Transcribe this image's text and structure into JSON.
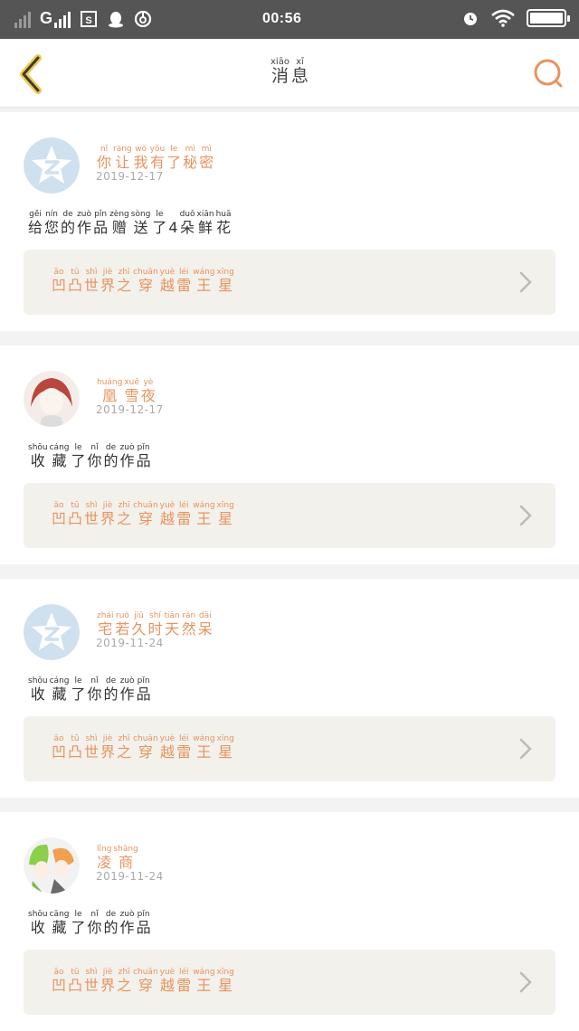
{
  "status_bar": {
    "carrier_label": "G",
    "time": "00:56",
    "icons": [
      "signal-icon-dim",
      "signal-icon",
      "sim-icon",
      "qq-icon",
      "netease-music-icon",
      "alarm-icon",
      "wifi-icon",
      "battery-icon"
    ],
    "battery_level": 1.0
  },
  "navbar": {
    "title": [
      {
        "py": "xiāo",
        "hz": "消"
      },
      {
        "py": "xī",
        "hz": "息"
      }
    ],
    "back_icon": "back-chevron-icon",
    "search_icon": "search-icon",
    "accent_color": "#e8935e"
  },
  "messages": [
    {
      "avatar": "qzone-default-avatar",
      "name": [
        {
          "py": "nǐ",
          "hz": "你"
        },
        {
          "py": "ràng",
          "hz": "让"
        },
        {
          "py": "wǒ",
          "hz": "我"
        },
        {
          "py": "yǒu",
          "hz": "有"
        },
        {
          "py": "le",
          "hz": "了"
        },
        {
          "py": "mì",
          "hz": "秘"
        },
        {
          "py": "mì",
          "hz": "密"
        }
      ],
      "date": "2019-12-17",
      "action": [
        {
          "py": "gěi",
          "hz": "给"
        },
        {
          "py": "nín",
          "hz": "您"
        },
        {
          "py": "de",
          "hz": "的"
        },
        {
          "py": "zuò",
          "hz": "作"
        },
        {
          "py": "pǐn",
          "hz": "品"
        },
        {
          "py": "zèng",
          "hz": "赠"
        },
        {
          "py": "sòng",
          "hz": "送"
        },
        {
          "py": "le",
          "hz": "了"
        },
        {
          "py": "",
          "hz": "4"
        },
        {
          "py": "duǒ",
          "hz": "朵"
        },
        {
          "py": "xiān",
          "hz": "鲜"
        },
        {
          "py": "huā",
          "hz": "花"
        }
      ],
      "work": [
        {
          "py": "āo",
          "hz": "凹"
        },
        {
          "py": "tū",
          "hz": "凸"
        },
        {
          "py": "shì",
          "hz": "世"
        },
        {
          "py": "jiè",
          "hz": "界"
        },
        {
          "py": "zhī",
          "hz": "之"
        },
        {
          "py": "chuān",
          "hz": "穿"
        },
        {
          "py": "yuè",
          "hz": "越"
        },
        {
          "py": "léi",
          "hz": "雷"
        },
        {
          "py": "wáng",
          "hz": "王"
        },
        {
          "py": "xīng",
          "hz": "星"
        }
      ]
    },
    {
      "avatar": "anime-girl-avatar",
      "name": [
        {
          "py": "huáng",
          "hz": "凰"
        },
        {
          "py": "xuě",
          "hz": "雪"
        },
        {
          "py": "yè",
          "hz": "夜"
        }
      ],
      "date": "2019-12-17",
      "action": [
        {
          "py": "shōu",
          "hz": "收"
        },
        {
          "py": "cáng",
          "hz": "藏"
        },
        {
          "py": "le",
          "hz": "了"
        },
        {
          "py": "nǐ",
          "hz": "你"
        },
        {
          "py": "de",
          "hz": "的"
        },
        {
          "py": "zuò",
          "hz": "作"
        },
        {
          "py": "pǐn",
          "hz": "品"
        }
      ],
      "work": [
        {
          "py": "āo",
          "hz": "凹"
        },
        {
          "py": "tū",
          "hz": "凸"
        },
        {
          "py": "shì",
          "hz": "世"
        },
        {
          "py": "jiè",
          "hz": "界"
        },
        {
          "py": "zhī",
          "hz": "之"
        },
        {
          "py": "chuān",
          "hz": "穿"
        },
        {
          "py": "yuè",
          "hz": "越"
        },
        {
          "py": "léi",
          "hz": "雷"
        },
        {
          "py": "wáng",
          "hz": "王"
        },
        {
          "py": "xīng",
          "hz": "星"
        }
      ]
    },
    {
      "avatar": "qzone-default-avatar",
      "name": [
        {
          "py": "zhái",
          "hz": "宅"
        },
        {
          "py": "ruò",
          "hz": "若"
        },
        {
          "py": "jiǔ",
          "hz": "久"
        },
        {
          "py": "shí",
          "hz": "时"
        },
        {
          "py": "tiān",
          "hz": "天"
        },
        {
          "py": "rán",
          "hz": "然"
        },
        {
          "py": "dāi",
          "hz": "呆"
        }
      ],
      "date": "2019-11-24",
      "action": [
        {
          "py": "shōu",
          "hz": "收"
        },
        {
          "py": "cáng",
          "hz": "藏"
        },
        {
          "py": "le",
          "hz": "了"
        },
        {
          "py": "nǐ",
          "hz": "你"
        },
        {
          "py": "de",
          "hz": "的"
        },
        {
          "py": "zuò",
          "hz": "作"
        },
        {
          "py": "pǐn",
          "hz": "品"
        }
      ],
      "work": [
        {
          "py": "āo",
          "hz": "凹"
        },
        {
          "py": "tū",
          "hz": "凸"
        },
        {
          "py": "shì",
          "hz": "世"
        },
        {
          "py": "jiè",
          "hz": "界"
        },
        {
          "py": "zhī",
          "hz": "之"
        },
        {
          "py": "chuān",
          "hz": "穿"
        },
        {
          "py": "yuè",
          "hz": "越"
        },
        {
          "py": "léi",
          "hz": "雷"
        },
        {
          "py": "wáng",
          "hz": "王"
        },
        {
          "py": "xīng",
          "hz": "星"
        }
      ]
    },
    {
      "avatar": "anime-duo-avatar",
      "name": [
        {
          "py": "lǐng",
          "hz": "凌"
        },
        {
          "py": "shāng",
          "hz": "商"
        }
      ],
      "date": "2019-11-24",
      "action": [
        {
          "py": "shōu",
          "hz": "收"
        },
        {
          "py": "cāng",
          "hz": "藏"
        },
        {
          "py": "le",
          "hz": "了"
        },
        {
          "py": "nǐ",
          "hz": "你"
        },
        {
          "py": "de",
          "hz": "的"
        },
        {
          "py": "zuò",
          "hz": "作"
        },
        {
          "py": "pǐn",
          "hz": "品"
        }
      ],
      "work": [
        {
          "py": "āo",
          "hz": "凹"
        },
        {
          "py": "tū",
          "hz": "凸"
        },
        {
          "py": "shì",
          "hz": "世"
        },
        {
          "py": "jiè",
          "hz": "界"
        },
        {
          "py": "zhī",
          "hz": "之"
        },
        {
          "py": "chuān",
          "hz": "穿"
        },
        {
          "py": "yuè",
          "hz": "越"
        },
        {
          "py": "léi",
          "hz": "雷"
        },
        {
          "py": "wáng",
          "hz": "王"
        },
        {
          "py": "xīng",
          "hz": "星"
        }
      ]
    }
  ]
}
